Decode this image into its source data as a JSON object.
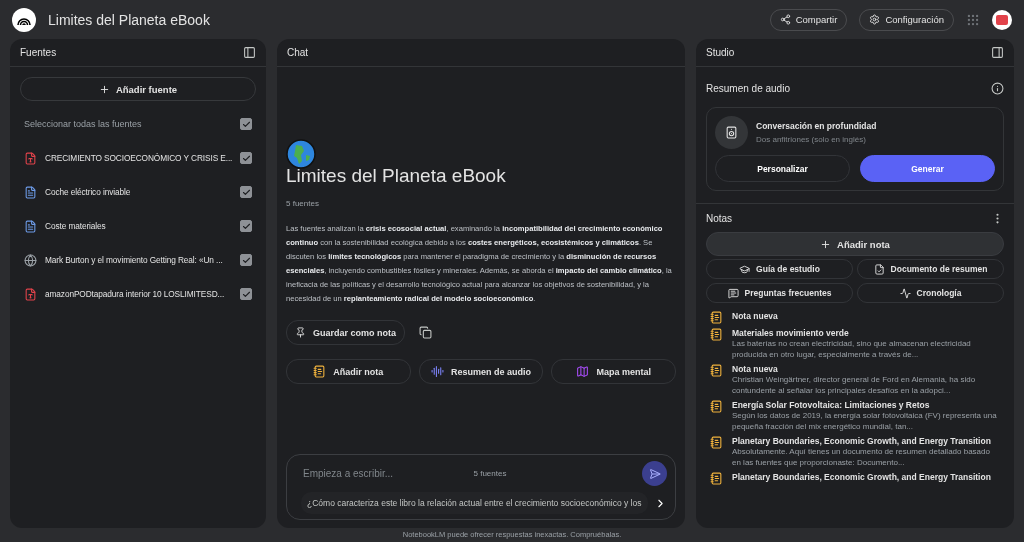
{
  "app": {
    "title": "Limites del Planeta eBook",
    "actions": [
      {
        "label": "Compartir",
        "kind": "share"
      },
      {
        "label": "Configuración",
        "kind": "settings"
      }
    ]
  },
  "sources": {
    "title": "Fuentes",
    "add_label": "Añadir fuente",
    "select_all": {
      "label": "Seleccionar todas las fuentes",
      "checked": true
    },
    "items": [
      {
        "name": "CRECIMIENTO SOCIOECONÓMICO Y CRISIS E...",
        "kind": "pdf",
        "checked": true
      },
      {
        "name": "Coche eléctrico inviable",
        "kind": "markdown",
        "checked": true
      },
      {
        "name": "Coste materiales",
        "kind": "doc",
        "checked": true
      },
      {
        "name": "Mark Burton y el movimiento Getting Real: «Un ...",
        "kind": "web",
        "checked": true
      },
      {
        "name": "amazonPODtapadura interior 10 LOSLIMITESD...",
        "kind": "pdf",
        "checked": true
      }
    ]
  },
  "chat": {
    "title": "Chat",
    "notebook_title": "Limites del Planeta eBook",
    "source_count": "5 fuentes",
    "summary": "Las fuentes analizan la **crisis ecosocial actual**, examinando la **incompatibilidad del crecimiento económico continuo** con la sostenibilidad ecológica debido a los **costes energéticos, ecosistémicos y climáticos**. Se discuten los **límites tecnológicos** para mantener el paradigma de crecimiento y la **disminución de recursos esenciales**, incluyendo combustibles fósiles y minerales. Además, se aborda el **impacto del cambio climático**, la ineficacia de las políticas y el desarrollo tecnológico actual para alcanzar los objetivos de sostenibilidad, y la necesidad de un **replanteamiento radical del modelo socioeconómico**.",
    "save_label": "Guardar como nota",
    "quick_actions": [
      {
        "label": "Añadir nota",
        "kind": "note"
      },
      {
        "label": "Resumen de audio",
        "kind": "audio"
      },
      {
        "label": "Mapa mental",
        "kind": "map"
      }
    ],
    "input": {
      "placeholder": "Empieza a escribir...",
      "source_count": "5 fuentes"
    },
    "suggestion": "¿Cómo caracteriza este libro la relación actual entre el crecimiento socioeconómico y los"
  },
  "studio": {
    "title": "Studio",
    "audio": {
      "title": "Resumen de audio",
      "card_title": "Conversación en profundidad",
      "card_subtitle": "Dos anfitriones (solo en inglés)",
      "buttons": [
        {
          "label": "Personalizar",
          "kind": "secondary"
        },
        {
          "label": "Generar",
          "kind": "primary"
        }
      ]
    },
    "notes": {
      "title": "Notas",
      "add_label": "Añadir nota",
      "tools": [
        {
          "label": "Guía de estudio",
          "kind": "study"
        },
        {
          "label": "Documento de resumen",
          "kind": "doc"
        },
        {
          "label": "Preguntas frecuentes",
          "kind": "faq"
        },
        {
          "label": "Cronología",
          "kind": "timeline"
        }
      ],
      "items": [
        {
          "title": "Nota nueva"
        },
        {
          "title": "Materiales movimiento verde",
          "preview": "Las baterías no crean electricidad, sino que almacenan electricidad producida en otro lugar, especialmente a través de..."
        },
        {
          "title": "Nota nueva",
          "preview": "Christian Weingärtner, director general de Ford en Alemania, ha sido contundente al señalar los principales desafíos en la adopci..."
        },
        {
          "title": "Energía Solar Fotovoltaica: Limitaciones y Retos",
          "preview": "Según los datos de 2019, la energía solar fotovoltaica (FV) representa una pequeña fracción del mix energético mundial, tan..."
        },
        {
          "title": "Planetary Boundaries, Economic Growth, and Energy Transition",
          "preview": "Absolutamente. Aquí tienes un documento de resumen detallado basado en las fuentes que proporcionaste: Documento..."
        },
        {
          "title": "Planetary Boundaries, Economic Growth, and Energy Transition"
        }
      ]
    }
  },
  "footer": "NotebookLM puede ofrecer respuestas inexactas. Compruébalas."
}
